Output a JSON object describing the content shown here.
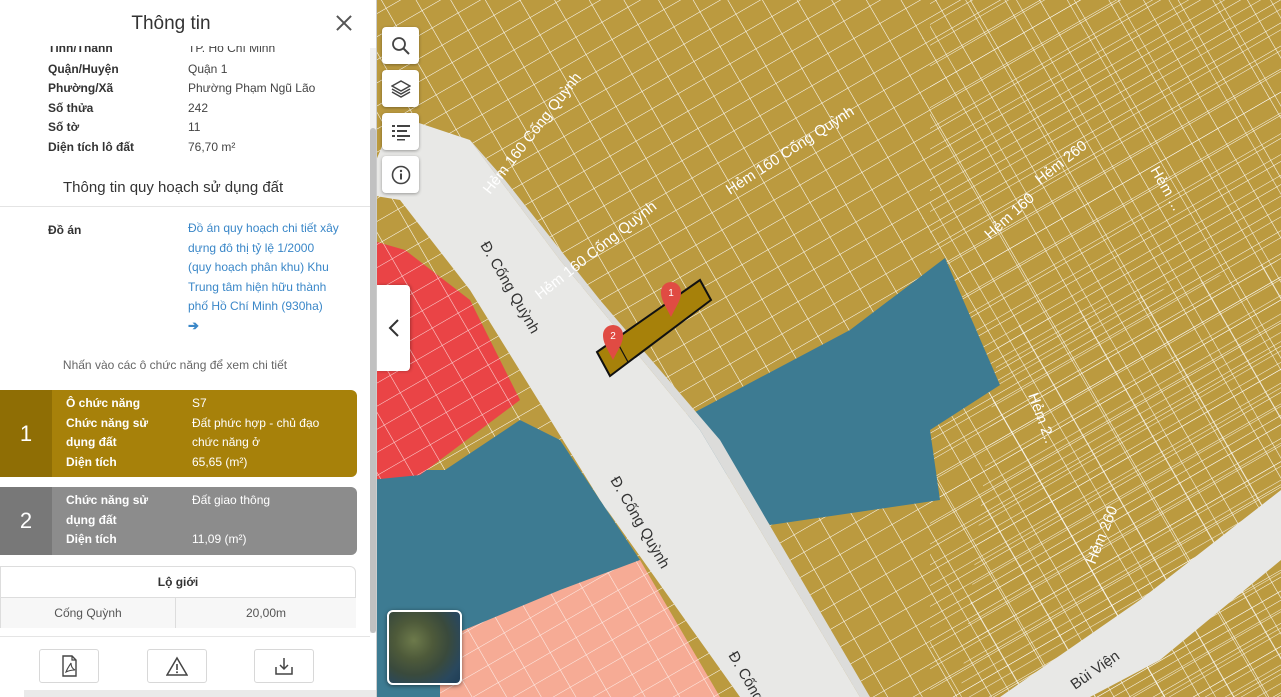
{
  "panel": {
    "title": "Thông tin",
    "info": [
      {
        "label": "Tỉnh/Thành",
        "value": "TP. Hồ Chí Minh"
      },
      {
        "label": "Quận/Huyện",
        "value": "Quận 1"
      },
      {
        "label": "Phường/Xã",
        "value": "Phường Phạm Ngũ Lão"
      },
      {
        "label": "Số thửa",
        "value": "242"
      },
      {
        "label": "Số tờ",
        "value": "11"
      },
      {
        "label": "Diện tích lô đất",
        "value": "76,70 m²"
      }
    ],
    "planning_title": "Thông tin quy hoạch sử dụng đất",
    "project_label": "Đồ án",
    "project_lines": [
      "Đồ án quy hoạch chi tiết xây",
      "dựng đô thị tỷ lệ 1/2000",
      "(quy hoạch phân khu) Khu",
      "Trung tâm hiện hữu thành",
      "phố Hồ Chí Minh (930ha)"
    ],
    "project_arrow": "➔",
    "hint": "Nhấn vào các ô chức năng để xem chi tiết",
    "functions": [
      {
        "number": "1",
        "color": "#a7810a",
        "label_color": "#8f6e05",
        "lines": [
          {
            "key": "Ô chức năng",
            "value": "S7"
          },
          {
            "key": "Chức năng sử",
            "value": "Đất phức hợp - chủ đạo"
          },
          {
            "key": "dụng đất",
            "value": "chức năng ở"
          },
          {
            "key": "Diện tích",
            "value": "65,65 (m²)"
          }
        ]
      },
      {
        "number": "2",
        "color": "#8c8c8c",
        "label_color": "#787878",
        "lines": [
          {
            "key": "Chức năng sử",
            "value": "Đất giao thông"
          },
          {
            "key": "dụng đất",
            "value": ""
          },
          {
            "key": "Diện tích",
            "value": "11,09 (m²)"
          }
        ]
      }
    ],
    "road_width": {
      "title": "Lộ giới",
      "road": "Cống Quỳnh",
      "width": "20,00m"
    }
  },
  "map": {
    "colors": {
      "residential": "#bb9a3f",
      "water_blue": "#3d7b92",
      "red": "#ea4446",
      "salmon": "#f6ab95",
      "road": "#e8e8e6",
      "highlight": "#a7810a",
      "pin": "#e04b43"
    },
    "labels": [
      "Hẻm 160 Cống Quỳnh",
      "Hẻm 160 Cống Quỳnh",
      "Hẻm 160 Cống Quỳnh",
      "Hẻm 160",
      "Hẻm 260",
      "Hẻm 260",
      "Hẻm 2..",
      "Đ. Cống Quỳnh",
      "Đ. Cống Quỳnh",
      "Đ. Cống",
      "Bùi Viện",
      "Hẻm ..."
    ],
    "pins": [
      "1",
      "2"
    ]
  },
  "icons": {
    "search": "search-icon",
    "layers": "layers-icon",
    "legend": "legend-list-icon",
    "info": "info-icon",
    "collapse": "chevron-left-icon",
    "pdf": "pdf-icon",
    "report": "warning-icon",
    "download": "download-icon"
  }
}
